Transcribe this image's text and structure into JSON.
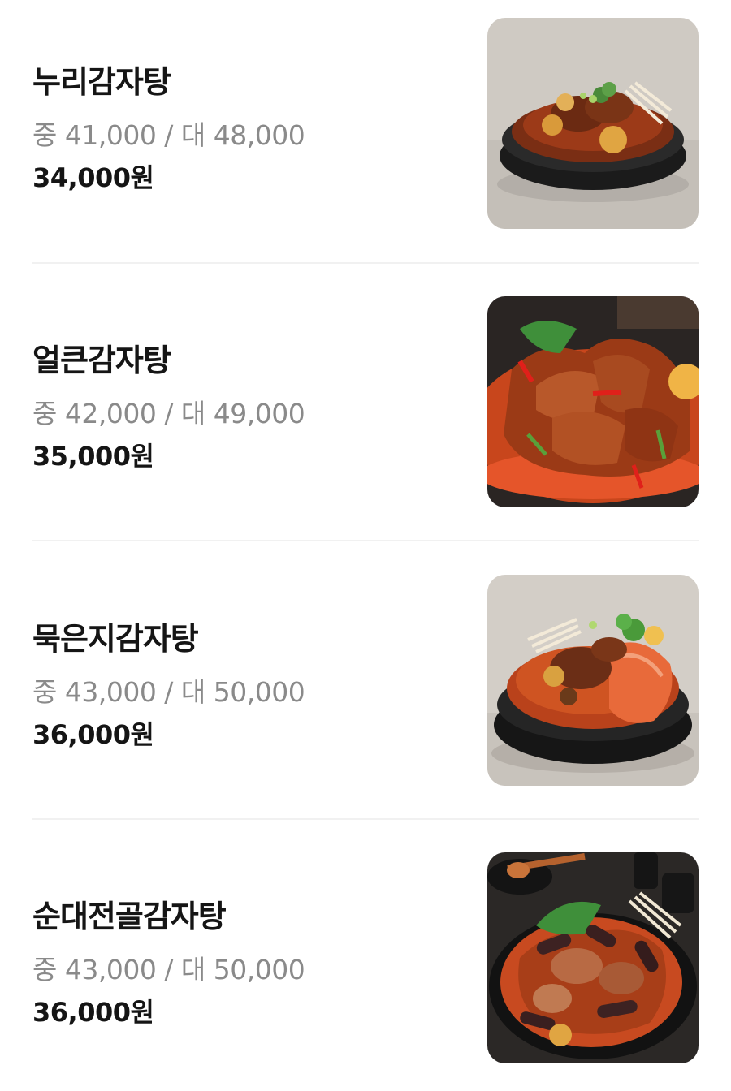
{
  "menu": {
    "items": [
      {
        "name": "누리감자탕",
        "prices": "중 41,000 / 대 48,000",
        "sale_price": "34,000원",
        "image_icon": "gamjatang-photo-icon"
      },
      {
        "name": "얼큰감자탕",
        "prices": "중 42,000 / 대 49,000",
        "sale_price": "35,000원",
        "image_icon": "spicy-gamjatang-photo-icon"
      },
      {
        "name": "묵은지감자탕",
        "prices": "중 43,000 / 대 50,000",
        "sale_price": "36,000원",
        "image_icon": "kimchi-gamjatang-photo-icon"
      },
      {
        "name": "순대전골감자탕",
        "prices": "중 43,000 / 대 50,000",
        "sale_price": "36,000원",
        "image_icon": "sundae-gamjatang-photo-icon"
      }
    ]
  },
  "colors": {
    "name_text": "#151515",
    "price_text": "#8a8a8a",
    "divider": "#f1f1f1",
    "stew_red": "#c94a1e"
  }
}
